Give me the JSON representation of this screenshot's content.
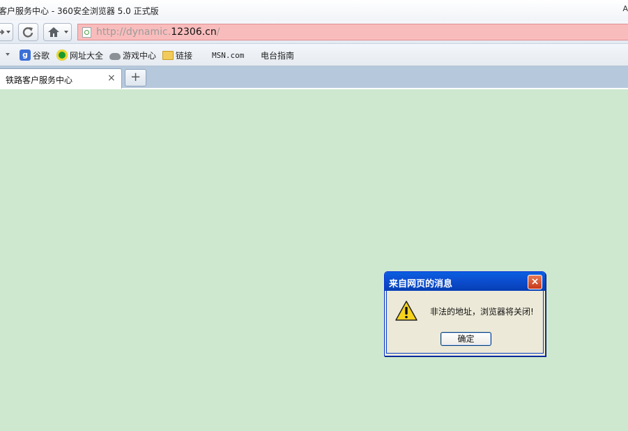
{
  "window": {
    "title": "客户服务中心 - 360安全浏览器 5.0 正式版",
    "title_right": "A"
  },
  "navigation": {
    "address_bar": {
      "url_prefix": "http://dynamic.",
      "url_domain": "12306.cn",
      "url_suffix": "/",
      "background_color": "#f9bcbc"
    },
    "icons": [
      "forward-icon",
      "refresh-icon",
      "home-icon"
    ]
  },
  "favorites": [
    {
      "label": "谷歌",
      "icon": "google-icon"
    },
    {
      "label": "网址大全",
      "icon": "site-directory-icon"
    },
    {
      "label": "游戏中心",
      "icon": "gamepad-icon"
    },
    {
      "label": "链接",
      "icon": "folder-icon"
    },
    {
      "label": "MSN.com",
      "icon": "windows-logo-icon"
    },
    {
      "label": "电台指南",
      "icon": "windows-logo-icon"
    }
  ],
  "tabs": {
    "active": {
      "label": "铁路客户服务中心",
      "close": "×"
    },
    "new_tab": "+"
  },
  "page": {
    "background_color": "#cde8cf"
  },
  "dialog": {
    "title": "来自网页的消息",
    "close": "×",
    "message": "非法的地址，浏览器将关闭!",
    "ok_button": "确定",
    "icon": "warning-icon"
  }
}
